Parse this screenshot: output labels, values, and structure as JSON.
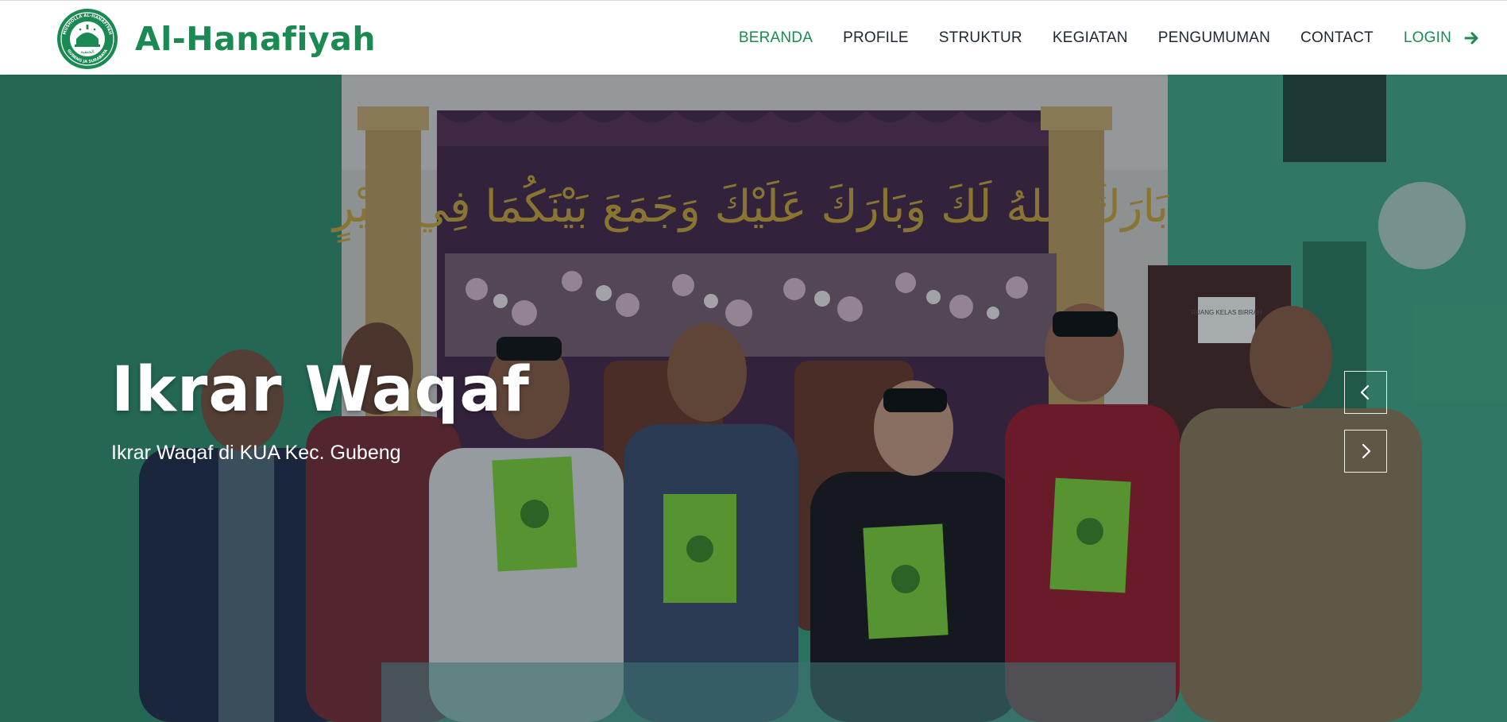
{
  "brand": {
    "name": "Al-Hanafiyah",
    "logo_text_top": "MUSHOLLA AL-HANAFIYAH",
    "logo_text_bottom": "GUBENG JA SURABAYA",
    "logo_text_arabic": "الحنفية"
  },
  "nav": {
    "items": [
      {
        "label": "BERANDA",
        "active": true
      },
      {
        "label": "PROFILE"
      },
      {
        "label": "STRUKTUR"
      },
      {
        "label": "KEGIATAN"
      },
      {
        "label": "PENGUMUMAN"
      },
      {
        "label": "CONTACT"
      }
    ],
    "login_label": "LOGIN",
    "login_icon": "arrow-right-icon"
  },
  "hero": {
    "title": "Ikrar Waqaf",
    "subtitle": "Ikrar Waqaf di KUA Kec. Gubeng",
    "banner_arabic": "بَارَكَ اللهُ لَكَ وَبَارَكَ عَلَيْكَ وَجَمَعَ بَيْنَكُمَا فِي خَيْرٍ",
    "door_sign": "RUANG KELAS BIRRAH",
    "prev_icon": "chevron-left-icon",
    "next_icon": "chevron-right-icon"
  },
  "colors": {
    "brand_green": "#1b8a52",
    "nav_text": "#1d2733",
    "wall_green": "#3a9a76",
    "folder_green": "#7ed23c"
  }
}
